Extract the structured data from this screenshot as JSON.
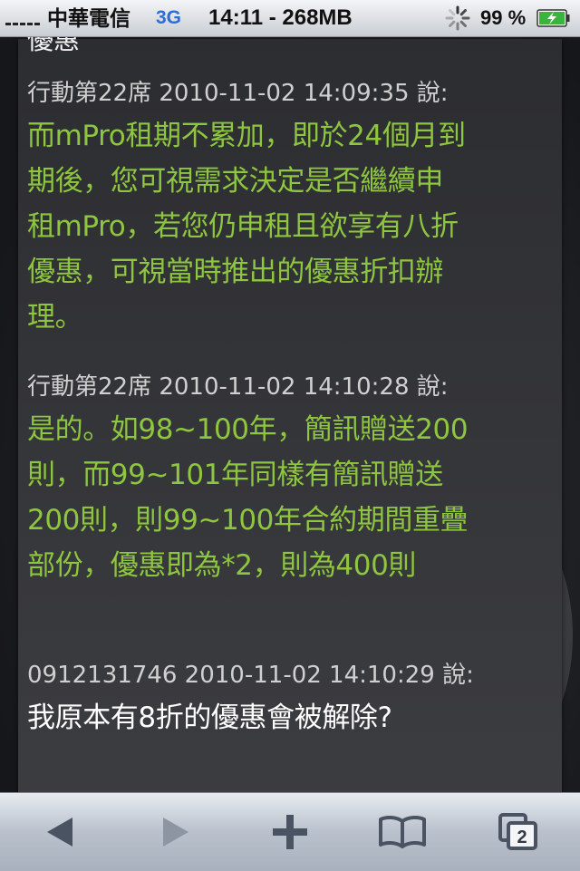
{
  "status_bar": {
    "carrier": "中華電信",
    "network": "3G",
    "time_memory": "14:11 - 268MB",
    "battery_percent": "99 %",
    "icons": [
      "signal-bars-icon",
      "activity-spinner-icon",
      "battery-charging-icon"
    ]
  },
  "chat": {
    "clipped_top_text": "優惠",
    "messages": [
      {
        "sender": "行動第22席",
        "timestamp": "2010-11-02 14:09:35",
        "says": "說:",
        "header": "行動第22席 2010-11-02 14:09:35 說:",
        "lines": [
          "而mPro租期不累加，即於24個月到",
          "期後，您可視需求決定是否繼續申",
          "租mPro，若您仍申租且欲享有八折",
          "優惠，可視當時推出的優惠折扣辦",
          "理。"
        ]
      },
      {
        "sender": "行動第22席",
        "timestamp": "2010-11-02 14:10:28",
        "says": "說:",
        "header": "行動第22席 2010-11-02 14:10:28 說:",
        "lines": [
          "是的。如98~100年，簡訊贈送200",
          "則，而99~101年同樣有簡訊贈送",
          "200則，則99~100年合約期間重疊",
          "部份，優惠即為*2，則為400則"
        ]
      },
      {
        "sender": "0912131746",
        "timestamp": "2010-11-02 14:10:29",
        "says": "說:",
        "header": "0912131746 2010-11-02 14:10:29 說:",
        "lines": [
          "我原本有8折的優惠會被解除?"
        ]
      }
    ]
  },
  "colors": {
    "agent_text": "#8ec63f",
    "user_text": "#ffffff",
    "header_text": "#d0d0d0",
    "card_background": "#333437"
  },
  "toolbar": {
    "pages_count": "2",
    "icons": [
      "back-arrow-icon",
      "forward-arrow-icon",
      "plus-icon",
      "bookmarks-book-icon",
      "pages-icon"
    ]
  }
}
